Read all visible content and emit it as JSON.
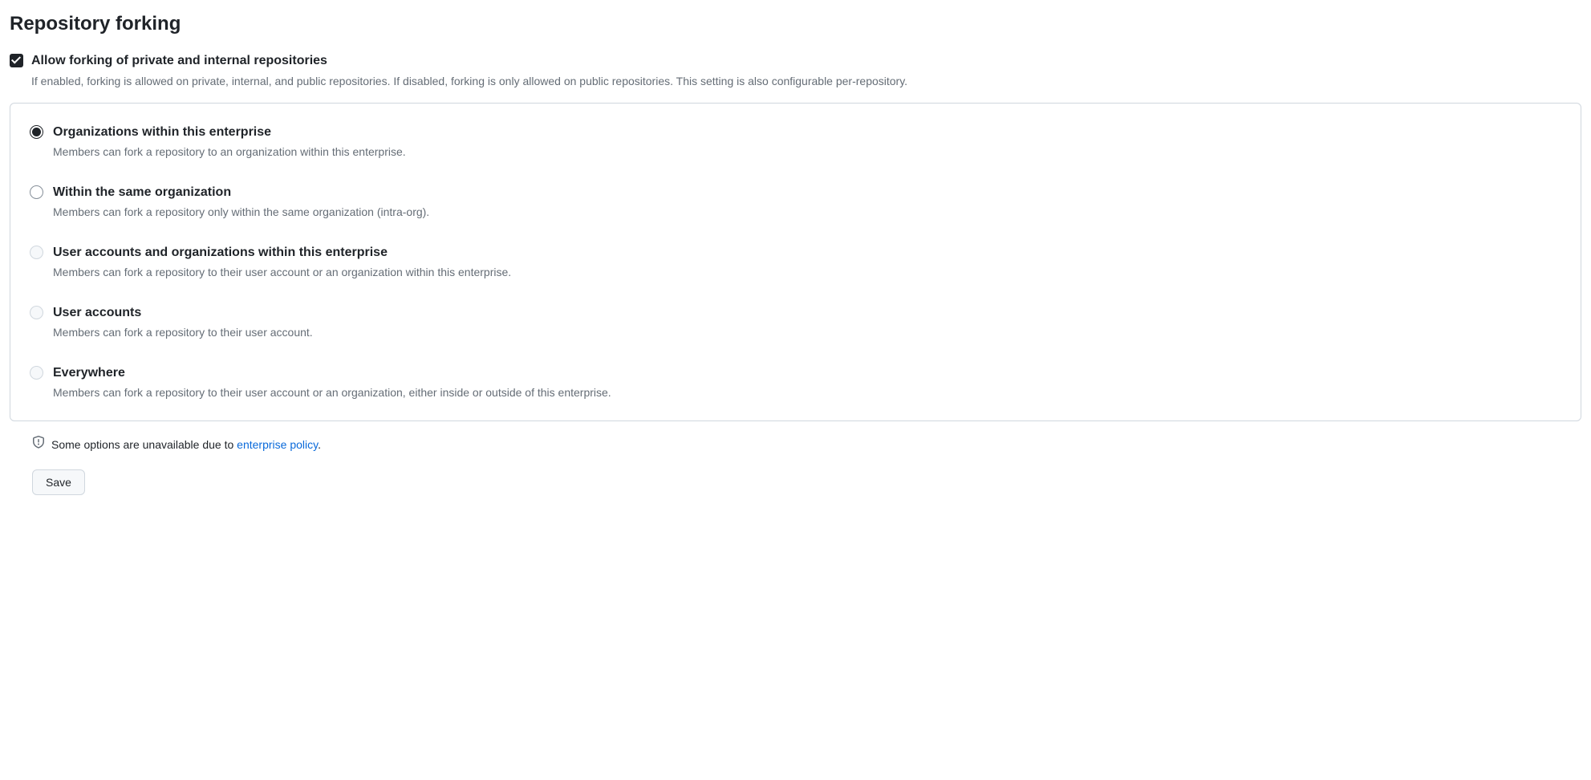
{
  "section": {
    "title": "Repository forking"
  },
  "checkbox": {
    "label": "Allow forking of private and internal repositories",
    "description": "If enabled, forking is allowed on private, internal, and public repositories. If disabled, forking is only allowed on public repositories. This setting is also configurable per-repository."
  },
  "radio_options": [
    {
      "label": "Organizations within this enterprise",
      "description": "Members can fork a repository to an organization within this enterprise."
    },
    {
      "label": "Within the same organization",
      "description": "Members can fork a repository only within the same organization (intra-org)."
    },
    {
      "label": "User accounts and organizations within this enterprise",
      "description": "Members can fork a repository to their user account or an organization within this enterprise."
    },
    {
      "label": "User accounts",
      "description": "Members can fork a repository to their user account."
    },
    {
      "label": "Everywhere",
      "description": "Members can fork a repository to their user account or an organization, either inside or outside of this enterprise."
    }
  ],
  "notice": {
    "prefix": "Some options are unavailable due to ",
    "link_text": "enterprise policy",
    "suffix": "."
  },
  "actions": {
    "save": "Save"
  }
}
